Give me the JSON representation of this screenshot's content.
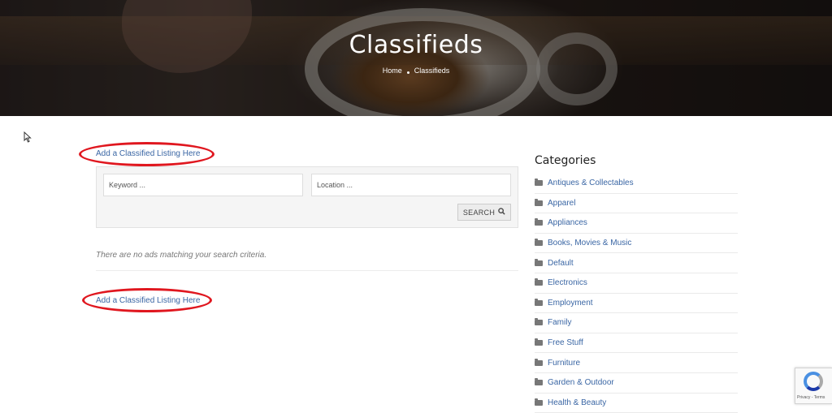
{
  "hero": {
    "title": "Classifieds",
    "breadcrumb": [
      "Home",
      "Classifieds"
    ]
  },
  "main": {
    "add_listing_top": "Add a Classified Listing Here",
    "add_listing_bottom": "Add a Classified Listing Here",
    "search": {
      "keyword_placeholder": "Keyword ...",
      "location_placeholder": "Location ...",
      "button_label": "SEARCH"
    },
    "no_results": "There are no ads matching your search criteria."
  },
  "sidebar": {
    "heading": "Categories",
    "categories": [
      "Antiques & Collectables",
      "Apparel",
      "Appliances",
      "Books, Movies & Music",
      "Default",
      "Electronics",
      "Employment",
      "Family",
      "Free Stuff",
      "Furniture",
      "Garden & Outdoor",
      "Health & Beauty"
    ]
  },
  "recaptcha": {
    "terms": "Privacy - Terms"
  },
  "colors": {
    "link": "#3a66a4",
    "annotation": "#e0171f"
  }
}
